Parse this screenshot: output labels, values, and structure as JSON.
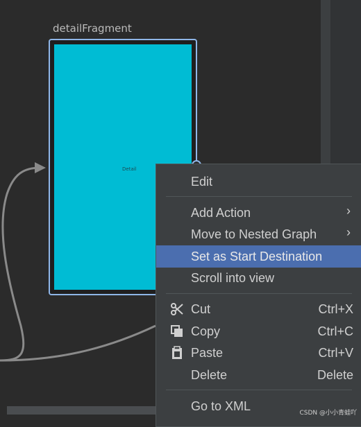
{
  "graph": {
    "fragment_label": "detailFragment",
    "fragment_preview_text": "Detail",
    "screen_color": "#00bcd4",
    "selection_color": "#8fb6e8"
  },
  "context_menu": {
    "items": [
      {
        "label": "Edit"
      },
      {
        "label": "Add Action",
        "submenu": true
      },
      {
        "label": "Move to Nested Graph",
        "submenu": true
      },
      {
        "label": "Set as Start Destination",
        "selected": true
      },
      {
        "label": "Scroll into view"
      },
      {
        "label": "Cut",
        "shortcut": "Ctrl+X",
        "icon": "scissors-icon"
      },
      {
        "label": "Copy",
        "shortcut": "Ctrl+C",
        "icon": "copy-icon"
      },
      {
        "label": "Paste",
        "shortcut": "Ctrl+V",
        "icon": "clipboard-icon"
      },
      {
        "label": "Delete",
        "shortcut": "Delete"
      },
      {
        "label": "Go to XML"
      }
    ],
    "highlight_color": "#4b6eaf"
  },
  "watermark": "CSDN @小小青蛙吖"
}
